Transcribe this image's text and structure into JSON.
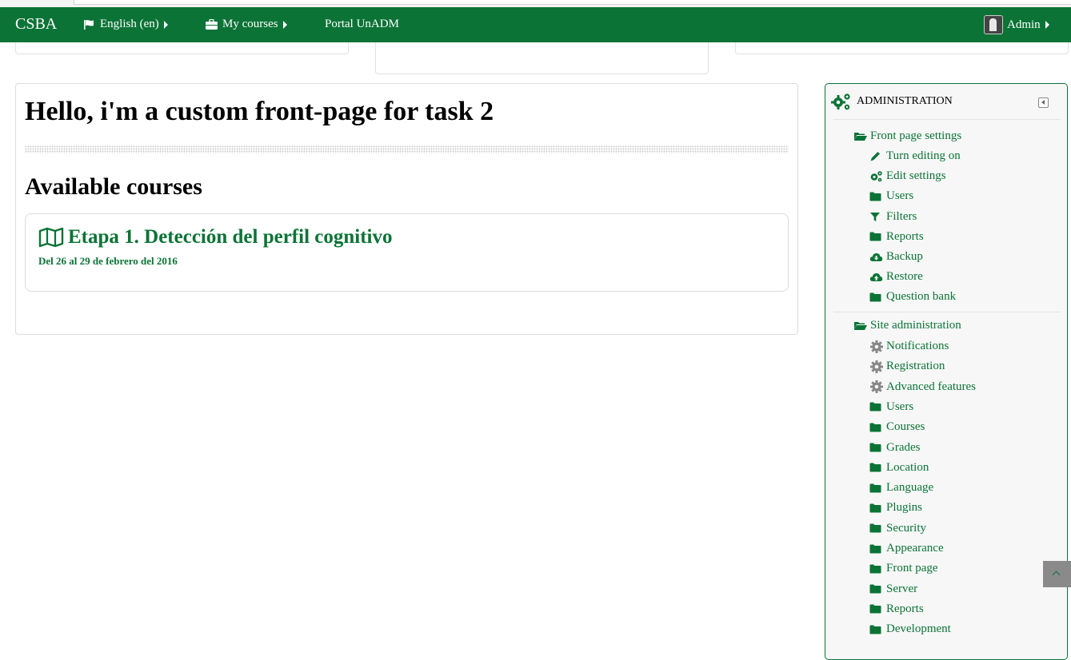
{
  "navbar": {
    "brand": "CSBA",
    "language": "English (en)",
    "my_courses": "My courses",
    "portal": "Portal UnADM",
    "user": "Admin"
  },
  "main": {
    "title": "Hello, i'm a custom front-page for task 2",
    "section_heading": "Available courses",
    "course": {
      "name": "Etapa 1. Detección del perfil cognitivo",
      "dates": "Del 26 al 29 de febrero del 2016"
    }
  },
  "admin": {
    "heading": "ADMINISTRATION",
    "front_page_settings": {
      "label": "Front page settings",
      "items": [
        {
          "label": "Turn editing on",
          "icon": "pencil-icon"
        },
        {
          "label": "Edit settings",
          "icon": "gears-icon"
        },
        {
          "label": "Users",
          "icon": "folder-icon"
        },
        {
          "label": "Filters",
          "icon": "filter-icon"
        },
        {
          "label": "Reports",
          "icon": "folder-icon"
        },
        {
          "label": "Backup",
          "icon": "cloud-download-icon"
        },
        {
          "label": "Restore",
          "icon": "cloud-upload-icon"
        },
        {
          "label": "Question bank",
          "icon": "folder-icon"
        }
      ]
    },
    "site_administration": {
      "label": "Site administration",
      "items": [
        {
          "label": "Notifications",
          "icon": "gear-icon"
        },
        {
          "label": "Registration",
          "icon": "gear-icon"
        },
        {
          "label": "Advanced features",
          "icon": "gear-icon"
        },
        {
          "label": "Users",
          "icon": "folder-icon"
        },
        {
          "label": "Courses",
          "icon": "folder-icon"
        },
        {
          "label": "Grades",
          "icon": "folder-icon"
        },
        {
          "label": "Location",
          "icon": "folder-icon"
        },
        {
          "label": "Language",
          "icon": "folder-icon"
        },
        {
          "label": "Plugins",
          "icon": "folder-icon"
        },
        {
          "label": "Security",
          "icon": "folder-icon"
        },
        {
          "label": "Appearance",
          "icon": "folder-icon"
        },
        {
          "label": "Front page",
          "icon": "folder-icon"
        },
        {
          "label": "Server",
          "icon": "folder-icon"
        },
        {
          "label": "Reports",
          "icon": "folder-icon"
        },
        {
          "label": "Development",
          "icon": "folder-icon"
        }
      ]
    }
  },
  "colors": {
    "brand_green": "#0b7336",
    "gear_grey": "#888888"
  }
}
